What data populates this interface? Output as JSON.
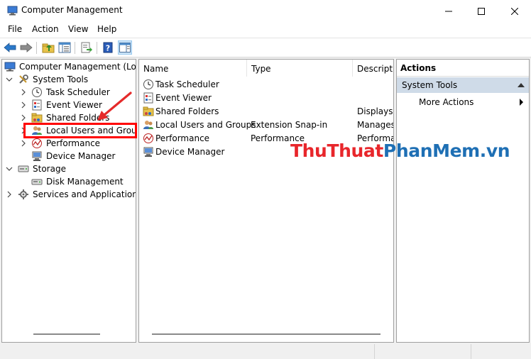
{
  "window": {
    "title": "Computer Management",
    "accent_color": "#0078d7"
  },
  "menu": [
    "File",
    "Action",
    "View",
    "Help"
  ],
  "toolbar": {
    "buttons": [
      "back-arrow-icon",
      "forward-arrow-icon",
      "up-folder-icon",
      "show-hide-tree-icon",
      "export-list-icon",
      "help-icon",
      "show-hide-action-pane-icon"
    ]
  },
  "tree": {
    "root": "Computer Management (Local",
    "system_tools": "System Tools",
    "task_scheduler": "Task Scheduler",
    "event_viewer": "Event Viewer",
    "shared_folders": "Shared Folders",
    "local_users_groups": "Local Users and Groups",
    "performance": "Performance",
    "device_manager": "Device Manager",
    "storage": "Storage",
    "disk_management": "Disk Management",
    "services_apps": "Services and Applications"
  },
  "list": {
    "columns": [
      "Name",
      "Type",
      "Descriptio"
    ],
    "rows": [
      {
        "name": "Task Scheduler",
        "type": "",
        "description": ""
      },
      {
        "name": "Event Viewer",
        "type": "",
        "description": ""
      },
      {
        "name": "Shared Folders",
        "type": "",
        "description": "Displays s"
      },
      {
        "name": "Local Users and Groups",
        "type": "Extension Snap-in",
        "description": "Manages"
      },
      {
        "name": "Performance",
        "type": "Performance",
        "description": "Performa"
      },
      {
        "name": "Device Manager",
        "type": "",
        "description": ""
      }
    ]
  },
  "actions": {
    "header": "Actions",
    "group": "System Tools",
    "more_actions": "More Actions"
  },
  "annotation": {
    "highlight_color": "#ff0000"
  },
  "watermark": {
    "part1": "ThuThuat",
    "part2": "PhanMem",
    "part3": ".vn",
    "color_red": "#e8262b",
    "color_blue": "#1e6fb4"
  }
}
